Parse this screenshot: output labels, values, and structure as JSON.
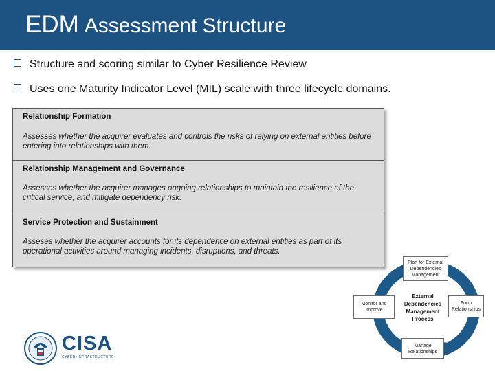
{
  "header": {
    "title_main": "EDM",
    "title_rest": "Assessment Structure",
    "background": "#1d5383"
  },
  "bullets": [
    "Structure and scoring similar to Cyber Resilience Review",
    "Uses one Maturity Indicator Level (MIL) scale with three lifecycle domains."
  ],
  "domains": [
    {
      "name": "Relationship Formation",
      "description": "Assesses whether the acquirer evaluates and controls the risks of relying on external entities before entering into relationships with them."
    },
    {
      "name": "Relationship Management and Governance",
      "description": "Assesses whether the acquirer manages ongoing relationships to maintain the resilience of the critical service, and mitigate dependency risk."
    },
    {
      "name": "Service Protection and Sustainment",
      "description": "Asseses whether the acquirer accounts for its dependence on external entities as part of its operational activities around managing incidents, disruptions, and threats."
    }
  ],
  "logo": {
    "acronym": "CISA",
    "subtitle": "CYBER+INFRASTRUCTURE",
    "seal_icon": "dhs-seal-icon"
  },
  "cycle": {
    "center": "External Dependencies Management Process",
    "top": "Plan for External Dependencies Management",
    "right": "Form Relationships",
    "bottom": "Manage Relationships",
    "left": "Monitor and Improve",
    "ring_color": "#1d5a8a"
  }
}
